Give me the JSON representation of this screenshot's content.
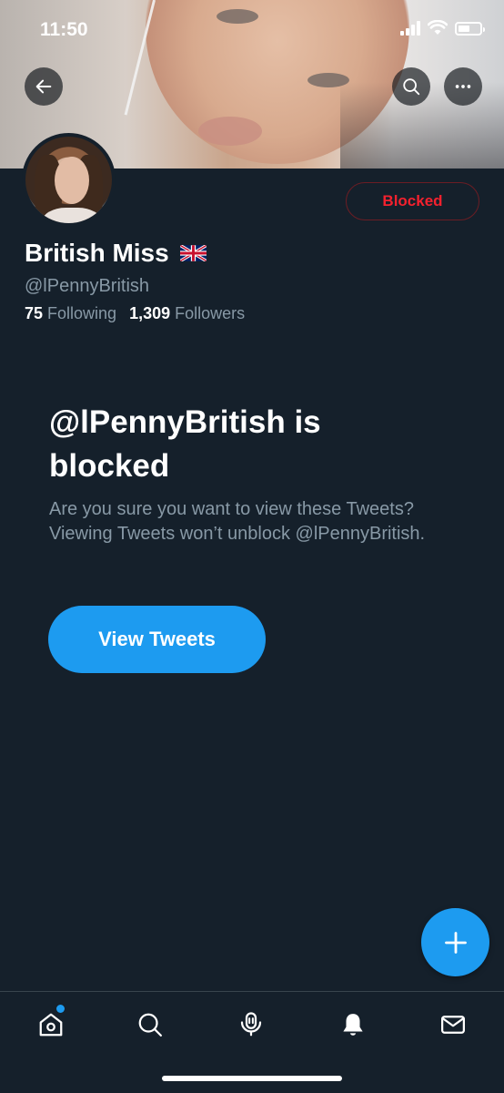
{
  "status_bar": {
    "time": "11:50"
  },
  "profile": {
    "name": "British Miss",
    "handle": "@lPennyBritish",
    "following_count": "75",
    "following_label": "Following",
    "followers_count": "1,309",
    "followers_label": "Followers",
    "blocked_button_label": "Blocked"
  },
  "notice": {
    "title": "@lPennyBritish is blocked",
    "body": "Are you sure you want to view these Tweets? Viewing Tweets won’t unblock @lPennyBritish.",
    "button_label": "View Tweets"
  },
  "icons": {
    "back": "arrow-left-icon",
    "search": "search-icon",
    "more": "more-icon",
    "compose": "plus-icon",
    "home": "home-icon",
    "explore": "search-icon",
    "spaces": "spaces-icon",
    "notifications": "bell-icon",
    "messages": "mail-icon"
  },
  "colors": {
    "background": "#15202b",
    "accent": "#1d9bf0",
    "blocked": "#f4212e",
    "secondary_text": "#8899a6"
  }
}
